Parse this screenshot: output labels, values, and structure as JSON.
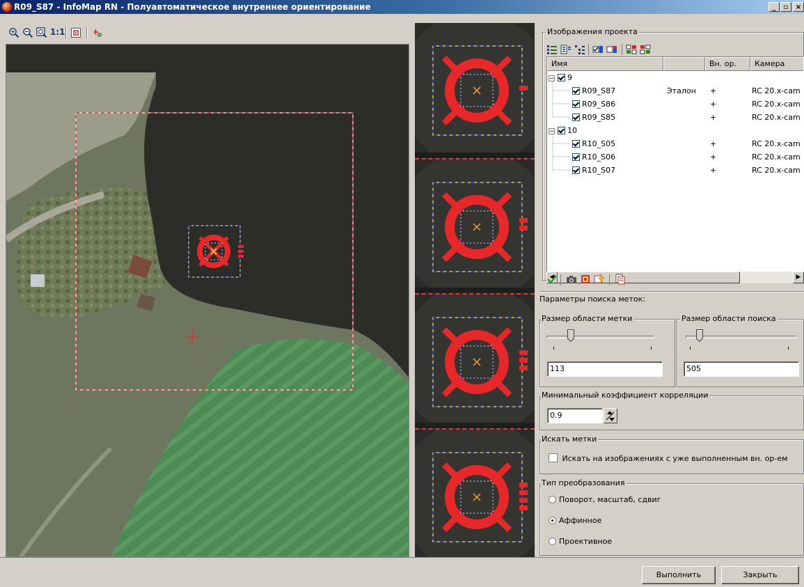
{
  "window": {
    "title": "R09_S87 - InfoMap RN - Полуавтоматическое внутреннее ориентирование",
    "controls": [
      "_",
      "▫",
      "×"
    ]
  },
  "toolbar": {
    "zoom_1to1_label": "1:1",
    "icons": [
      "zoom-in-icon",
      "zoom-out-icon",
      "zoom-fit-icon",
      "zoom-1to1-icon",
      "center-mark-icon",
      "mark-pointer-icon"
    ]
  },
  "project_images": {
    "legend": "Изображения проекта",
    "columns": [
      "Имя",
      "",
      "Вн. ор.",
      "Камера"
    ],
    "groups": [
      {
        "name": "9",
        "checked": true,
        "items": [
          {
            "name": "R09_S87",
            "role": "Эталон",
            "inner": "+",
            "camera": "RC 20.x-cam",
            "checked": true
          },
          {
            "name": "R09_S86",
            "role": "",
            "inner": "+",
            "camera": "RC 20.x-cam",
            "checked": true
          },
          {
            "name": "R09_S85",
            "role": "",
            "inner": "+",
            "camera": "RC 20.x-cam",
            "checked": true
          }
        ]
      },
      {
        "name": "10",
        "checked": true,
        "items": [
          {
            "name": "R10_S05",
            "role": "",
            "inner": "+",
            "camera": "RC 20.x-cam",
            "checked": true
          },
          {
            "name": "R10_S06",
            "role": "",
            "inner": "+",
            "camera": "RC 20.x-cam",
            "checked": true
          },
          {
            "name": "R10_S07",
            "role": "",
            "inner": "+",
            "camera": "RC 20.x-cam",
            "checked": true
          }
        ]
      }
    ]
  },
  "search_params": {
    "title": "Параметры поиска меток:",
    "mark_area_legend": "Размер области метки",
    "mark_area_value": "113",
    "search_area_legend": "Размер области поиска",
    "search_area_value": "505"
  },
  "correlation": {
    "legend": "Минимальный коэффициент корреляции",
    "value": "0.9"
  },
  "find_marks": {
    "legend": "Искать метки",
    "checkbox_label": "Искать на изображениях  с уже выполненным вн. ор-ем",
    "checked": false
  },
  "transform_type": {
    "legend": "Тип преобразования",
    "options": [
      "Поворот, масштаб, сдвиг",
      "Аффинное",
      "Проективное"
    ],
    "selected": "Аффинное"
  },
  "buttons": {
    "run": "Выполнить",
    "close": "Закрыть"
  },
  "colors": {
    "mark_red": "#e82828",
    "frame_yellow": "#f5e042",
    "frame_blue": "#1c2bd0"
  }
}
